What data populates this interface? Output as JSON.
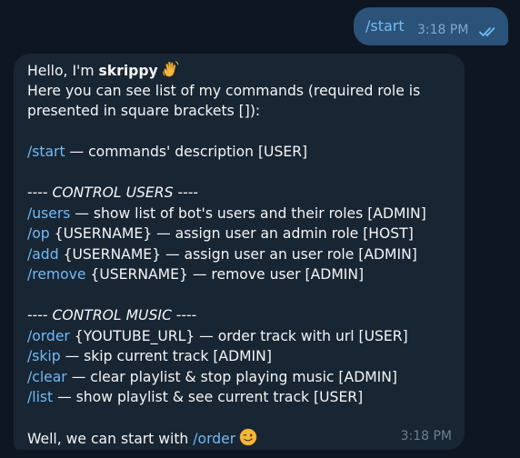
{
  "outgoing": {
    "text": "/start",
    "time": "3:18 PM",
    "status_icon": "double-check-icon"
  },
  "incoming": {
    "time": "3:18 PM",
    "greeting_prefix": "Hello, I'm ",
    "bot_name": "skrippy",
    "greeting_emoji": "waving-hand-icon",
    "intro_line1": "Here you can see list of my commands (required role is",
    "intro_line2": "presented in square brackets []):",
    "start": {
      "cmd": "/start",
      "desc": " — commands' description [USER]"
    },
    "control_users_prefix": "---- ",
    "control_users_title": "CONTROL USERS",
    "control_users_suffix": " ----",
    "users": {
      "cmd": "/users",
      "desc": " — show list of bot's users and their roles [ADMIN]"
    },
    "op": {
      "cmd": "/op",
      "desc": " {USERNAME} — assign user an admin role [HOST]"
    },
    "add": {
      "cmd": "/add",
      "desc": " {USERNAME} — assign user an user role [ADMIN]"
    },
    "remove": {
      "cmd": "/remove",
      "desc": " {USERNAME} — remove user [ADMIN]"
    },
    "control_music_prefix": "---- ",
    "control_music_title": "CONTROL MUSIC",
    "control_music_suffix": " ----",
    "order": {
      "cmd": "/order",
      "desc": " {YOUTUBE_URL} — order track with url [USER]"
    },
    "skip": {
      "cmd": "/skip",
      "desc": " — skip current track [ADMIN]"
    },
    "clear": {
      "cmd": "/clear",
      "desc": " — clear playlist & stop playing music [ADMIN]"
    },
    "list": {
      "cmd": "/list",
      "desc": " — show playlist & see current track [USER]"
    },
    "closing_prefix": "Well, we can start with ",
    "closing_cmd": "/order",
    "closing_emoji": "winking-face-icon"
  }
}
